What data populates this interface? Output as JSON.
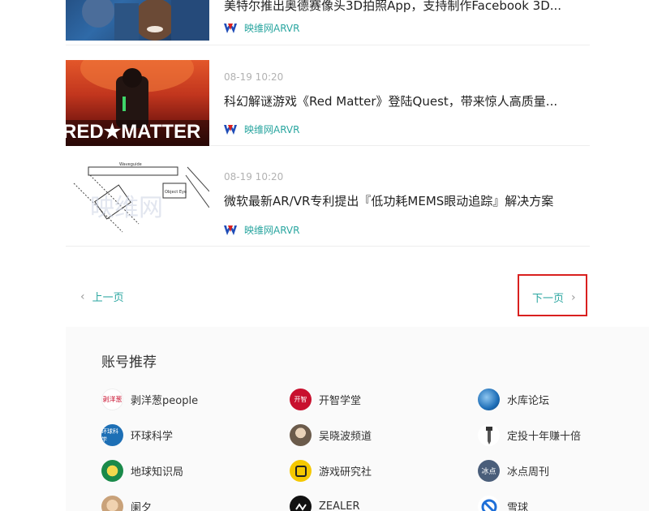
{
  "articles": [
    {
      "time": "",
      "title": "美特尔推出奥德赛像头3D拍照App，支持制作Facebook 3D...",
      "source": "映维网ARVR"
    },
    {
      "time": "08-19 10:20",
      "title": "科幻解谜游戏《Red Matter》登陆Quest，带来惊人高质量...",
      "source": "映维网ARVR",
      "thumb_text": "RED★MATTER"
    },
    {
      "time": "08-19 10:20",
      "title": "微软最新AR/VR专利提出『低功耗MEMS眼动追踪』解决方案",
      "source": "映维网ARVR",
      "thumb_labels": [
        "Waveguide",
        "Object Eye"
      ],
      "thumb_watermark": "映维网"
    }
  ],
  "pager": {
    "prev": "上一页",
    "next": "下一页"
  },
  "recommend": {
    "title": "账号推荐",
    "accounts": [
      {
        "name": "剥洋葱people",
        "avatar_text": "剥洋葱",
        "color": "#ffffff"
      },
      {
        "name": "开智学堂",
        "avatar_text": "开智",
        "color": "#c8102e"
      },
      {
        "name": "水库论坛",
        "avatar_text": "",
        "color": "#1f6fb8"
      },
      {
        "name": "环球科学",
        "avatar_text": "环球科学",
        "color": "#1d6fb5"
      },
      {
        "name": "吴晓波频道",
        "avatar_text": "",
        "color": "#6b5b4b"
      },
      {
        "name": "定投十年赚十倍",
        "avatar_text": "",
        "color": "#ffffff"
      },
      {
        "name": "地球知识局",
        "avatar_text": "",
        "color": "#1a8a4a"
      },
      {
        "name": "游戏研究社",
        "avatar_text": "",
        "color": "#f5c800"
      },
      {
        "name": "冰点周刊",
        "avatar_text": "冰点",
        "color": "#4a5e7a"
      },
      {
        "name": "阑夕",
        "avatar_text": "",
        "color": "#c9a27a"
      },
      {
        "name": "ZEALER",
        "avatar_text": "",
        "color": "#111111"
      },
      {
        "name": "雪球",
        "avatar_text": "",
        "color": "#ffffff"
      }
    ]
  }
}
